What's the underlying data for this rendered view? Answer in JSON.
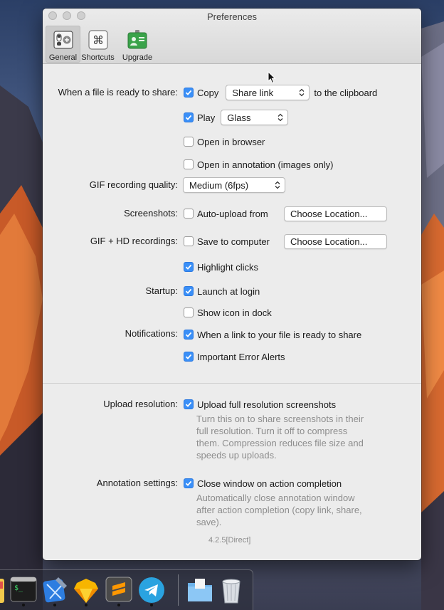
{
  "window": {
    "title": "Preferences",
    "toolbar": [
      {
        "label": "General",
        "icon": "general-switch-icon",
        "active": true
      },
      {
        "label": "Shortcuts",
        "icon": "command-key-icon",
        "active": false
      },
      {
        "label": "Upgrade",
        "icon": "badge-upgrade-icon",
        "active": false
      }
    ]
  },
  "share": {
    "label": "When a file is ready to share:",
    "copy": {
      "label": "Copy",
      "checked": true,
      "select_value": "Share link",
      "suffix": "to the clipboard"
    },
    "play": {
      "label": "Play",
      "checked": true,
      "select_value": "Glass"
    },
    "open_browser": {
      "label": "Open in browser",
      "checked": false
    },
    "open_annotation": {
      "label": "Open in annotation (images only)",
      "checked": false
    }
  },
  "gif_quality": {
    "label": "GIF recording quality:",
    "select_value": "Medium (6fps)"
  },
  "screenshots": {
    "label": "Screenshots:",
    "auto_upload": {
      "label": "Auto-upload from",
      "checked": false
    },
    "button": "Choose Location..."
  },
  "recordings": {
    "label": "GIF + HD recordings:",
    "save": {
      "label": "Save to computer",
      "checked": false
    },
    "button": "Choose Location...",
    "highlight": {
      "label": "Highlight clicks",
      "checked": true
    }
  },
  "startup": {
    "label": "Startup:",
    "launch": {
      "label": "Launch at login",
      "checked": true
    },
    "dock_icon": {
      "label": "Show icon in dock",
      "checked": false
    }
  },
  "notifications": {
    "label": "Notifications:",
    "link_ready": {
      "label": "When a link to your file is ready to share",
      "checked": true
    },
    "errors": {
      "label": "Important Error Alerts",
      "checked": true
    }
  },
  "upload_resolution": {
    "label": "Upload resolution:",
    "option": {
      "label": "Upload full resolution screenshots",
      "checked": true
    },
    "help": [
      "Turn this on to share screenshots in their",
      "full resolution. Turn it off to compress",
      "them. Compression reduces file size and",
      "speeds up uploads."
    ]
  },
  "annotation_settings": {
    "label": "Annotation settings:",
    "option": {
      "label": "Close window on action completion",
      "checked": true
    },
    "help": [
      "Automatically close annotation window",
      "after action completion (copy link, share,",
      "save)."
    ]
  },
  "version": "4.2.5[Direct]",
  "dock": {
    "items": [
      {
        "icon": "app-partial-icon",
        "running": false
      },
      {
        "icon": "terminal-icon",
        "running": true
      },
      {
        "icon": "xcode-icon",
        "running": true
      },
      {
        "icon": "sketch-icon",
        "running": true
      },
      {
        "icon": "sublime-text-icon",
        "running": true
      },
      {
        "icon": "telegram-icon",
        "running": true
      },
      {
        "icon": "downloads-folder-icon",
        "running": false
      },
      {
        "icon": "trash-icon",
        "running": false
      }
    ]
  },
  "colors": {
    "accent": "#3a8ff7",
    "window_bg": "#ececec",
    "help_text": "#8d8d8d"
  }
}
